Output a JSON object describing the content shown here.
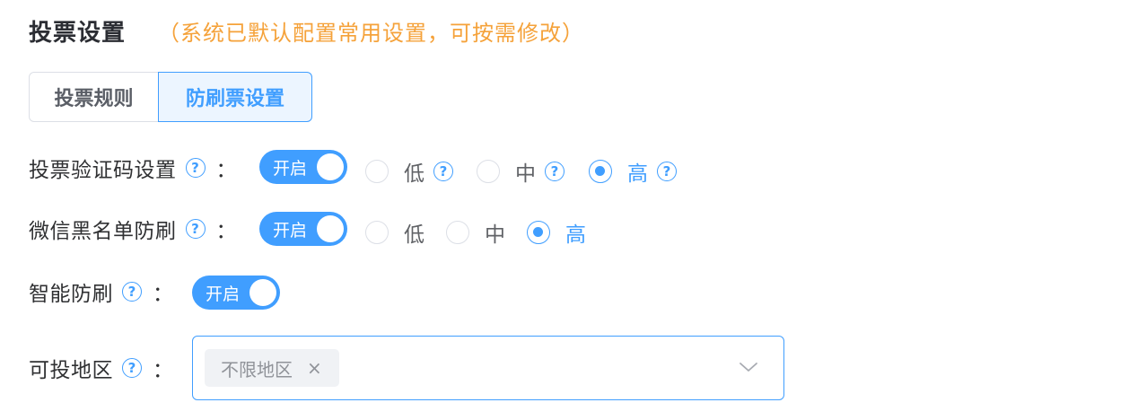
{
  "header": {
    "title": "投票设置",
    "note": "（系统已默认配置常用设置，可按需修改）"
  },
  "tabs": [
    {
      "label": "投票规则",
      "active": false
    },
    {
      "label": "防刷票设置",
      "active": true
    }
  ],
  "colors": {
    "accent": "#409eff",
    "note": "#f5a23a"
  },
  "help_glyph": "?",
  "colon": "：",
  "rows": {
    "captcha": {
      "label": "投票验证码设置",
      "switch": {
        "label": "开启",
        "on": true
      },
      "options": [
        "低",
        "中",
        "高"
      ],
      "selected": "高"
    },
    "wechat_blacklist": {
      "label": "微信黑名单防刷",
      "switch": {
        "label": "开启",
        "on": true
      },
      "options": [
        "低",
        "中",
        "高"
      ],
      "selected": "高"
    },
    "smart": {
      "label": "智能防刷",
      "switch": {
        "label": "开启",
        "on": true
      }
    },
    "region": {
      "label": "可投地区",
      "tags": [
        "不限地区"
      ],
      "tag_close": "×"
    }
  }
}
